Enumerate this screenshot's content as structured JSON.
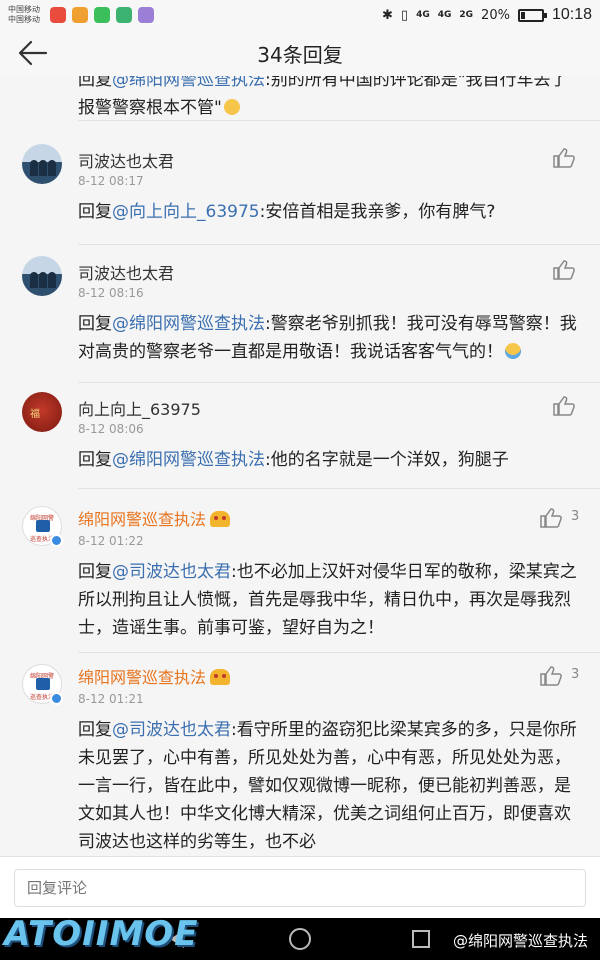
{
  "status_bar": {
    "carrier_1": "中国移动",
    "carrier_2": "中国移动",
    "signal_1": "4G",
    "signal_2": "4G",
    "signal_3": "2G",
    "battery": "20%",
    "battery_level": 0.2,
    "time": "10:18",
    "app_icon_colors": [
      "#e94b3c",
      "#f0a030",
      "#3bbf5a",
      "#3cb371",
      "#9b7fd6"
    ]
  },
  "header": {
    "title": "34条回复",
    "back_icon": "arrow-left-icon"
  },
  "partial_top": {
    "prefix": "回复",
    "mention": "@绵阳网警巡查执法",
    "text": ":别的所有中国的评论都是\"我自行车丢了",
    "line2": "报警警察根本不管\""
  },
  "comments": [
    {
      "username": "司波达也太君",
      "time": "8-12 08:17",
      "reply_prefix": "回复",
      "mention": "@向上向上_63975",
      "text": ":安倍首相是我亲爹，你有脾气?"
    },
    {
      "username": "司波达也太君",
      "time": "8-12 08:16",
      "reply_prefix": "回复",
      "mention": "@绵阳网警巡查执法",
      "text": ":警察老爷别抓我！我可没有辱骂警察！我对高贵的警察老爷一直都是用敬语！我说话客客气气的！"
    },
    {
      "username": "向上向上_63975",
      "avatar_text": "福",
      "time": "8-12 08:06",
      "reply_prefix": "回复",
      "mention": "@绵阳网警巡查执法",
      "text": ":他的名字就是一个洋奴，狗腿子"
    },
    {
      "username": "绵阳网警巡查执法",
      "avatar_top": "绵阳网警",
      "avatar_bottom": "巡查执法",
      "time": "8-12 01:22",
      "likes": "3",
      "reply_prefix": "回复",
      "mention": "@司波达也太君",
      "text": ":也不必加上汉奸对侵华日军的敬称，梁某宾之所以刑拘且让人愤慨，首先是辱我中华，精日仇中，再次是辱我烈士，造谣生事。前事可鉴，望好自为之！"
    },
    {
      "username": "绵阳网警巡查执法",
      "avatar_top": "绵阳网警",
      "avatar_bottom": "巡查执法",
      "time": "8-12 01:21",
      "likes": "3",
      "reply_prefix": "回复",
      "mention": "@司波达也太君",
      "text": ":看守所里的盗窃犯比梁某宾多的多，只是你所未见罢了，心中有善，所见处处为善，心中有恶，所见处处为恶，一言一行，皆在此中，譬如仅观微博一昵称，便已能初判善恶，是文如其人也！中华文化博大精深，优美之词组何止百万，即便喜欢司波达也这样的劣等生，也不必"
    }
  ],
  "bottom_bar": {
    "placeholder": "回复评论"
  },
  "watermark": {
    "left_text": "ATOIIMOE",
    "right_text": "@绵阳网警巡查执法"
  },
  "colors": {
    "mention": "#3b6fb0",
    "verified_name": "#e8741e",
    "background": "#f5f5f5"
  }
}
